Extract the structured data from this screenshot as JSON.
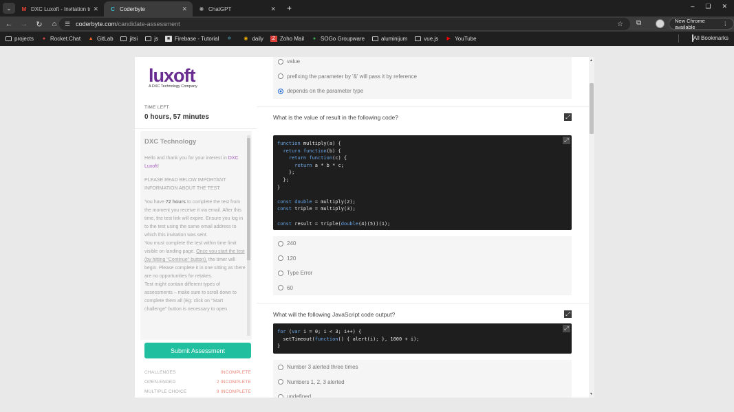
{
  "browser": {
    "tabs": [
      {
        "title": "DXC Luxoft - Invitation to C",
        "icon": "gmail-icon",
        "active": false
      },
      {
        "title": "Coderbyte",
        "icon": "coderbyte-icon",
        "active": true
      },
      {
        "title": "ChatGPT",
        "icon": "chatgpt-icon",
        "active": false
      }
    ],
    "url_domain": "coderbyte.com",
    "url_path": "/candidate-assessment",
    "update_label": "New Chrome available",
    "bookmarks": [
      {
        "label": "projects",
        "icon": "folder"
      },
      {
        "label": "Rocket.Chat",
        "icon": "rocket"
      },
      {
        "label": "GitLab",
        "icon": "gitlab"
      },
      {
        "label": "jitsi",
        "icon": "folder"
      },
      {
        "label": "js",
        "icon": "folder"
      },
      {
        "label": "Firebase - Tutorial",
        "icon": "firebase"
      },
      {
        "label": "",
        "icon": "react"
      },
      {
        "label": "daily",
        "icon": "chrome"
      },
      {
        "label": "Zoho Mail",
        "icon": "zoho"
      },
      {
        "label": "SOGo Groupware",
        "icon": "sogo"
      },
      {
        "label": "aluminijum",
        "icon": "folder"
      },
      {
        "label": "vue.js",
        "icon": "folder"
      },
      {
        "label": "YouTube",
        "icon": "youtube"
      }
    ],
    "all_bookmarks": "All Bookmarks"
  },
  "sidebar": {
    "logo_text": "luxoft",
    "logo_subtitle": "A DXC Technology Company",
    "time_label": "TIME LEFT",
    "time_value": "0 hours, 57 minutes",
    "company_title": "DXC Technology",
    "intro_pre": "Hello and thank you for your interest in ",
    "intro_company": "DXC Luxoft",
    "intro_post": "!",
    "read_below": "PLEASE READ BELOW IMPORTANT INFORMATION ABOUT THE TEST:",
    "p1_pre": "You have ",
    "p1_hours": "72 hours",
    "p1_post": " to complete the test from the moment you receive it via email. After this time, the test link will expire. Ensure you log in to the test using the same email address to which this invitation was sent.",
    "p2_pre": "You must complete the test within time limit visible on landing page. ",
    "p2_link": "Once you start the test (by hitting \"Continue\" button),",
    "p2_post": " the timer will begin. Please complete it in one sitting as there are no opportunities for retakes.",
    "p3": "Test might contain different types of assessments – make sure to scroll down to complete them all (Eg: click on \"Start challenge\" button is necessary to open",
    "submit_label": "Submit Assessment",
    "stats": [
      {
        "label": "CHALLENGES",
        "value": "INCOMPLETE"
      },
      {
        "label": "OPEN-ENDED",
        "value": "2 INCOMPLETE"
      },
      {
        "label": "MULTIPLE CHOICE",
        "value": "9 INCOMPLETE"
      }
    ]
  },
  "questions": {
    "prev_options": [
      "value",
      "prefixing the parameter by '&' will pass it by reference",
      "depends on the parameter type"
    ],
    "prev_selected": 2,
    "q1_text": "What is the value of result in the following code?",
    "q1_code": "function multiply(a) {\n  return function(b) {\n    return function(c) {\n      return a * b * c;\n    };\n  };\n}\n\nconst double = multiply(2);\nconst triple = multiply(3);\n\nconst result = triple(double(4)(5))(1);",
    "q1_options": [
      "240",
      "120",
      "Type Error",
      "60"
    ],
    "q2_text": "What will the following JavaScript code output?",
    "q2_code": "for (var i = 0; i < 3; i++) {\n  setTimeout(function() { alert(i); }, 1000 + i);\n}",
    "q2_options": [
      "Number 3 alerted three times",
      "Numbers 1, 2, 3 alerted",
      "undefined"
    ]
  }
}
